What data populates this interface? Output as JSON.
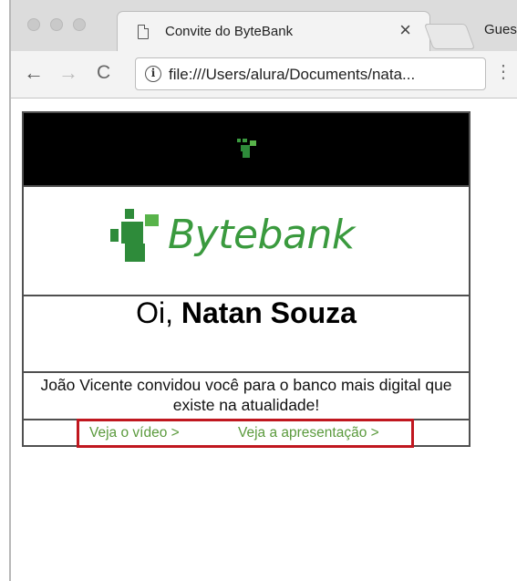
{
  "browser": {
    "tab_title": "Convite do ByteBank",
    "tab_close": "×",
    "profile_label": "Guest",
    "address_bar": {
      "info_icon_glyph": "i",
      "url": "file:///Users/alura/Documents/nata..."
    },
    "nav": {
      "back": "←",
      "forward": "→",
      "reload": "C"
    },
    "menu": "⋮"
  },
  "email": {
    "brand_name": "Bytebank",
    "greeting_prefix": "Oi, ",
    "recipient_name": "Natan Souza",
    "invite_message": "João Vicente convidou você para o banco mais digital que existe na atualidade!",
    "links": {
      "video_label": "Veja o vídeo >",
      "presentation_label": "Veja a apresentação >"
    }
  },
  "colors": {
    "brand_green_dark": "#2e8b3a",
    "brand_green_light": "#58b34a",
    "link_green": "#5a9a3c",
    "highlight_red": "#c0171f",
    "header_bg": "#000000"
  }
}
